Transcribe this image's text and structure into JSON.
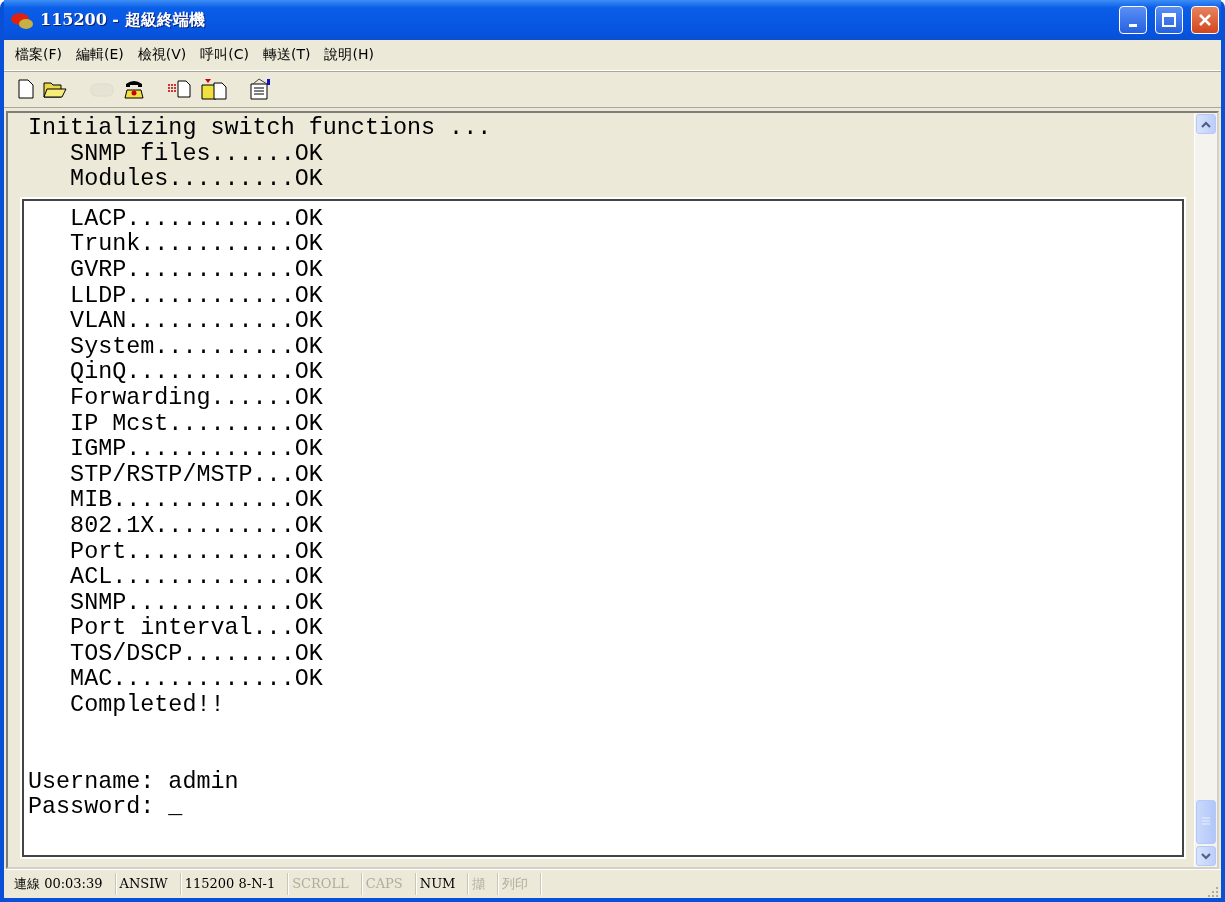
{
  "window": {
    "title": "115200 - 超級終端機"
  },
  "menu": [
    "檔案(F)",
    "編輯(E)",
    "檢視(V)",
    "呼叫(C)",
    "轉送(T)",
    "說明(H)"
  ],
  "toolbar": [
    {
      "kind": "new",
      "disabled": false
    },
    {
      "kind": "open",
      "disabled": false
    },
    {
      "kind": "disconnect",
      "disabled": true
    },
    {
      "kind": "dial",
      "disabled": false
    },
    {
      "kind": "send",
      "disabled": false
    },
    {
      "kind": "receive",
      "disabled": false
    },
    {
      "kind": "properties",
      "disabled": false
    }
  ],
  "scrollback": [
    "Initializing switch functions ...",
    "   SNMP files......OK",
    "   Modules.........OK"
  ],
  "screen": [
    "   LACP............OK",
    "   Trunk...........OK",
    "   GVRP............OK",
    "   LLDP............OK",
    "   VLAN............OK",
    "   System..........OK",
    "   QinQ............OK",
    "   Forwarding......OK",
    "   IP Mcst.........OK",
    "   IGMP............OK",
    "   STP/RSTP/MSTP...OK",
    "   MIB.............OK",
    "   802.1X..........OK",
    "   Port............OK",
    "   ACL.............OK",
    "   SNMP............OK",
    "   Port interval...OK",
    "   TOS/DSCP........OK",
    "   MAC.............OK",
    "   Completed!!"
  ],
  "login": [
    "Username: admin",
    "Password: _"
  ],
  "status_bar": [
    {
      "text": "連線 00:03:39",
      "active": true
    },
    {
      "text": "ANSIW",
      "active": true
    },
    {
      "text": "115200 8-N-1",
      "active": true
    },
    {
      "text": "SCROLL",
      "active": false
    },
    {
      "text": "CAPS",
      "active": false
    },
    {
      "text": "NUM",
      "active": true
    },
    {
      "text": "擷",
      "active": false
    },
    {
      "text": "列印",
      "active": false
    }
  ]
}
